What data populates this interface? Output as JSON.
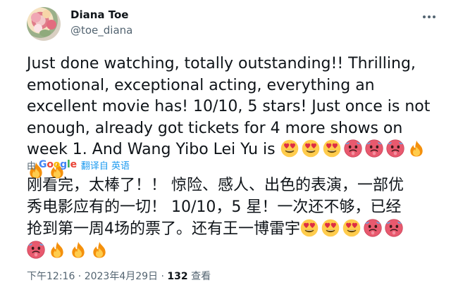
{
  "author": {
    "name": "Diana Toe",
    "handle": "@toe_diana"
  },
  "tweet": {
    "text": "Just done watching, totally outstanding!! Thrilling, emotional, exceptional acting, everything an excellent movie has! 10/10, 5 stars! Just once is not enough, already got tickets for 4 more shows on week 1. And Wang Yibo Lei Yu is ",
    "trailing_emojis": [
      "heart-eyes-icon",
      "heart-eyes-icon",
      "heart-eyes-icon",
      "hot-face-icon",
      "hot-face-icon",
      "hot-face-icon",
      "fire-icon",
      "fire-icon",
      "fire-icon"
    ]
  },
  "translation_bar": {
    "by_label": "由",
    "provider": "Google",
    "translated_from": "翻译自 英语"
  },
  "translated_tweet": {
    "line1": "刚看完，太棒了！！ 惊险、感人、出色的表演，一部优",
    "line2": "秀电影应有的一切！ 10/10，5 星！一次还不够，已经",
    "line3": "抢到第一周4场的票了。还有王一博雷宇",
    "emojis_line3": [
      "heart-eyes-icon",
      "heart-eyes-icon",
      "heart-eyes-icon",
      "hot-face-icon",
      "hot-face-icon"
    ],
    "emojis_line4": [
      "hot-face-icon",
      "fire-icon",
      "fire-icon",
      "fire-icon"
    ]
  },
  "meta": {
    "timestamp": "下午12:16 · 2023年4月29日 · ",
    "view_count": "132",
    "view_label": " 查看"
  },
  "colors": {
    "text": "#0f1419",
    "secondary": "#536471",
    "link": "#1d9bf0"
  }
}
